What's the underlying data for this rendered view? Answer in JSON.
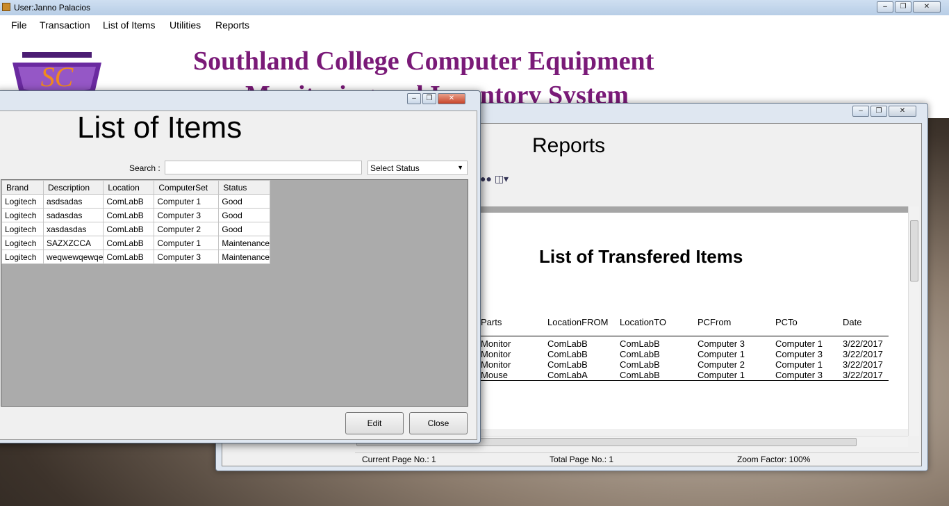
{
  "main_window": {
    "title": "User:Janno Palacios",
    "menu": [
      "File",
      "Transaction",
      "List of Items",
      "Utilities",
      "Reports"
    ],
    "system_title_line1": "Southland College Computer Equipment",
    "system_title_line2": "Monitoring and Inventory System",
    "logo_text": "SC"
  },
  "reports_window": {
    "title": "Reports",
    "report_heading": "List of Transfered Items",
    "columns": [
      "Parts",
      "LocationFROM",
      "LocationTO",
      "PCFrom",
      "PCTo",
      "Date"
    ],
    "rows": [
      [
        "Monitor",
        "ComLabB",
        "ComLabB",
        "Computer 3",
        "Computer 1",
        "3/22/2017"
      ],
      [
        "Monitor",
        "ComLabB",
        "ComLabB",
        "Computer 1",
        "Computer 3",
        "3/22/2017"
      ],
      [
        "Monitor",
        "ComLabB",
        "ComLabB",
        "Computer 2",
        "Computer 1",
        "3/22/2017"
      ],
      [
        "Mouse",
        "ComLabA",
        "ComLabB",
        "Computer 1",
        "Computer 3",
        "3/22/2017"
      ]
    ],
    "status": {
      "current_page": "Current Page No.: 1",
      "total_page": "Total Page No.: 1",
      "zoom": "Zoom Factor: 100%"
    }
  },
  "items_window": {
    "title": "List of Items",
    "search_label": "Search :",
    "search_value": "",
    "status_select": "Select Status",
    "columns": [
      "Brand",
      "Description",
      "Location",
      "ComputerSet",
      "Status"
    ],
    "rows": [
      [
        "Logitech",
        "asdsadas",
        "ComLabB",
        "Computer 1",
        "Good"
      ],
      [
        "Logitech",
        "sadasdas",
        "ComLabB",
        "Computer 3",
        "Good"
      ],
      [
        "Logitech",
        "xasdasdas",
        "ComLabB",
        "Computer 2",
        "Good"
      ],
      [
        "Logitech",
        "SAZXZCCA",
        "ComLabB",
        "Computer 1",
        "Maintenance"
      ],
      [
        "Logitech",
        "weqwewqewqe",
        "ComLabB",
        "Computer 3",
        "Maintenance"
      ]
    ],
    "edit_label": "Edit",
    "close_label": "Close"
  },
  "colors": {
    "title_purple": "#7a1a78",
    "grid_background": "#ababab"
  }
}
